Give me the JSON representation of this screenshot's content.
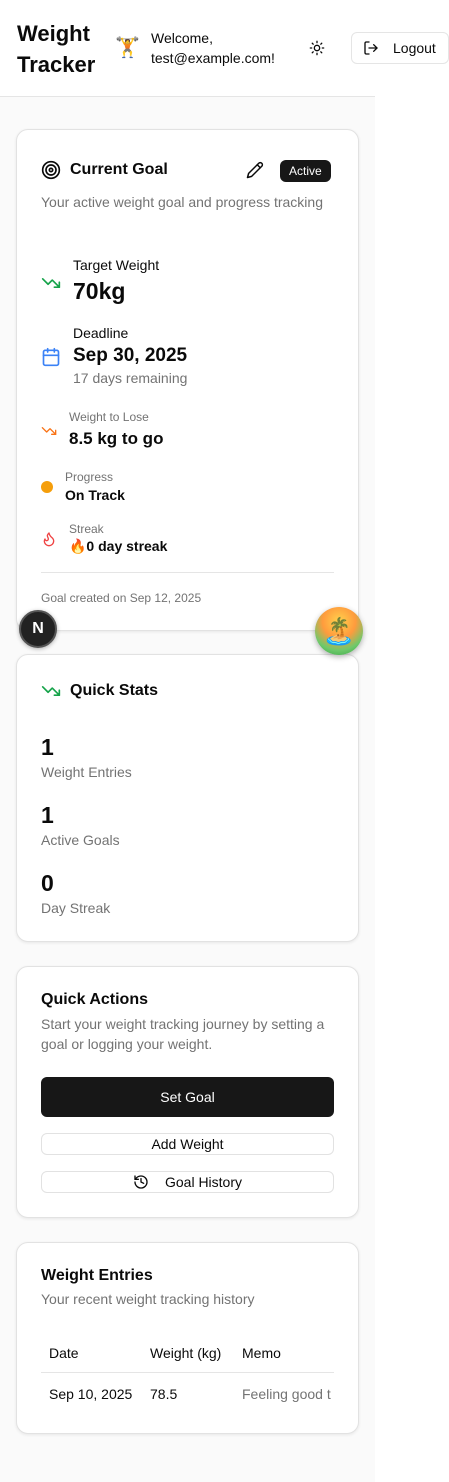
{
  "header": {
    "title": "Weight Tracker",
    "welcome_line1": "Welcome,",
    "welcome_line2": "test@example.com!",
    "avatar_emoji": "🏋️",
    "logout_label": "Logout"
  },
  "goal": {
    "title": "Current Goal",
    "status_badge": "Active",
    "description": "Your active weight goal and progress tracking",
    "target_label": "Target Weight",
    "target_value": "70kg",
    "deadline_label": "Deadline",
    "deadline_value": "Sep 30, 2025",
    "deadline_sub": "17 days remaining",
    "lose_label": "Weight to Lose",
    "lose_value": "8.5 kg to go",
    "progress_label": "Progress",
    "progress_value": "On Track",
    "streak_label": "Streak",
    "streak_value": "🔥0 day streak",
    "created": "Goal created on Sep 12, 2025"
  },
  "floating": {
    "n_badge": "N",
    "island_emoji": "🏝️"
  },
  "stats": {
    "title": "Quick Stats",
    "items": [
      {
        "value": "1",
        "label": "Weight Entries"
      },
      {
        "value": "1",
        "label": "Active Goals"
      },
      {
        "value": "0",
        "label": "Day Streak"
      }
    ]
  },
  "actions": {
    "title": "Quick Actions",
    "description": "Start your weight tracking journey by setting a goal or logging your weight.",
    "set_goal": "Set Goal",
    "add_weight": "Add Weight",
    "goal_history": "Goal History"
  },
  "entries": {
    "title": "Weight Entries",
    "description": "Your recent weight tracking history",
    "columns": [
      "Date",
      "Weight (kg)",
      "Memo"
    ],
    "rows": [
      {
        "date": "Sep 10, 2025",
        "weight": "78.5",
        "memo": "Feeling good t"
      }
    ]
  },
  "colors": {
    "accent_dark": "#171717",
    "trend_green": "#16a34a",
    "deadline_blue": "#3b82f6",
    "lose_orange": "#f97316",
    "progress_amber": "#f59e0b",
    "streak_red": "#ef4444"
  }
}
